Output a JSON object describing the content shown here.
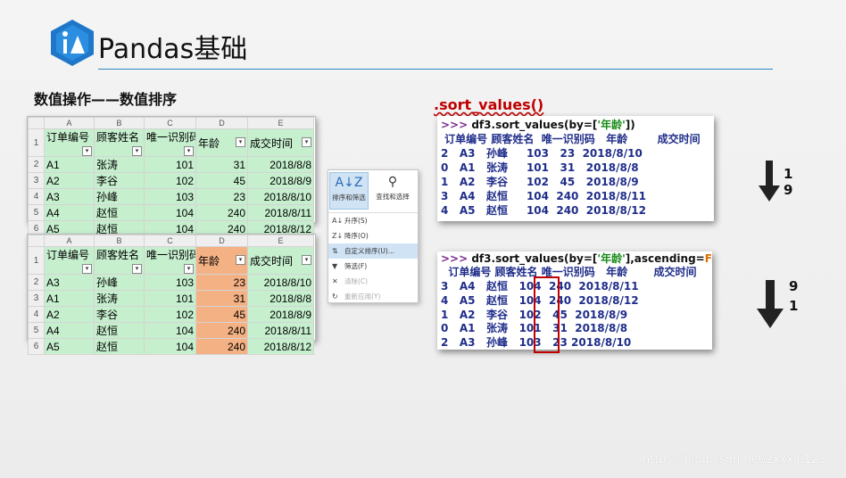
{
  "slide": {
    "title": "Pandas基础",
    "subtitle": "数值操作——数值排序",
    "method_label": ".sort_values()",
    "watermark": "https://blog.csdn.net/zxxxlh123",
    "accent_color": "#2e86c1"
  },
  "excel_top": {
    "col_letters": [
      "A",
      "B",
      "C",
      "D",
      "E"
    ],
    "headers": [
      "订单编号",
      "顾客姓名",
      "唯一识别码",
      "年龄",
      "成交时间"
    ],
    "rows": [
      {
        "n": "1",
        "c": [
          "订单编号",
          "顾客姓名",
          "唯一识别码",
          "年龄",
          "成交时间"
        ]
      },
      {
        "n": "2",
        "c": [
          "A1",
          "张涛",
          "101",
          "31",
          "2018/8/8"
        ]
      },
      {
        "n": "3",
        "c": [
          "A2",
          "李谷",
          "102",
          "45",
          "2018/8/9"
        ]
      },
      {
        "n": "4",
        "c": [
          "A3",
          "孙峰",
          "103",
          "23",
          "2018/8/10"
        ]
      },
      {
        "n": "5",
        "c": [
          "A4",
          "赵恒",
          "104",
          "240",
          "2018/8/11"
        ]
      },
      {
        "n": "6",
        "c": [
          "A5",
          "赵恒",
          "104",
          "240",
          "2018/8/12"
        ]
      }
    ]
  },
  "excel_bottom": {
    "col_letters": [
      "A",
      "B",
      "C",
      "D",
      "E"
    ],
    "rows": [
      {
        "n": "1",
        "c": [
          "订单编号",
          "顾客姓名",
          "唯一识别码",
          "年龄",
          "成交时间"
        ]
      },
      {
        "n": "2",
        "c": [
          "A3",
          "孙峰",
          "103",
          "23",
          "2018/8/10"
        ]
      },
      {
        "n": "3",
        "c": [
          "A1",
          "张涛",
          "101",
          "31",
          "2018/8/8"
        ]
      },
      {
        "n": "4",
        "c": [
          "A2",
          "李谷",
          "102",
          "45",
          "2018/8/9"
        ]
      },
      {
        "n": "5",
        "c": [
          "A4",
          "赵恒",
          "104",
          "240",
          "2018/8/11"
        ]
      },
      {
        "n": "6",
        "c": [
          "A5",
          "赵恒",
          "104",
          "240",
          "2018/8/12"
        ]
      }
    ]
  },
  "excel_menu": {
    "sort_filter": "排序和筛选",
    "find_select": "查找和选择",
    "items": [
      {
        "label": "升序(S)",
        "icon": "sort-asc-icon",
        "glyph": "A↓",
        "disabled": false
      },
      {
        "label": "降序(O)",
        "icon": "sort-desc-icon",
        "glyph": "Z↓",
        "disabled": false
      },
      {
        "label": "自定义排序(U)...",
        "icon": "custom-sort-icon",
        "glyph": "⇅",
        "disabled": false
      },
      {
        "label": "筛选(F)",
        "icon": "filter-icon",
        "glyph": "▼",
        "disabled": false
      },
      {
        "label": "清除(C)",
        "icon": "clear-filter-icon",
        "glyph": "✕",
        "disabled": true
      },
      {
        "label": "重新应用(Y)",
        "icon": "reapply-icon",
        "glyph": "↻",
        "disabled": true
      }
    ]
  },
  "code_asc": {
    "prompt": ">>> ",
    "cmd_a": "df3.sort_values(by=[",
    "cmd_str": "'年龄'",
    "cmd_b": "])",
    "header": " 订单编号 顾客姓名  唯一识别码   年龄        成交时间",
    "rows": [
      "2   A3   孙峰     103   23  2018/8/10",
      "0   A1   张涛     101   31   2018/8/8",
      "1   A2   李谷     102   45   2018/8/9",
      "3   A4   赵恒     104  240  2018/8/11",
      "4   A5   赵恒     104  240  2018/8/12"
    ]
  },
  "code_desc": {
    "prompt": ">>> ",
    "cmd_a": "df3.sort_values(by=[",
    "cmd_str": "'年龄'",
    "cmd_b": "],ascending=",
    "cmd_kw": "False",
    "cmd_c": ")",
    "header": "  订单编号 顾客姓名 唯一识别码   年龄       成交时间",
    "rows": [
      "3   A4   赵恒   104  240  2018/8/11",
      "4   A5   赵恒   104  240  2018/8/12",
      "1   A2   李谷   102   45  2018/8/9",
      "0   A1   张涛   101   31  2018/8/8",
      "2   A3   孙峰   103   23 2018/8/10"
    ]
  },
  "arrows": {
    "asc_top": "1",
    "asc_bottom": "9",
    "desc_top": "9",
    "desc_bottom": "1"
  }
}
